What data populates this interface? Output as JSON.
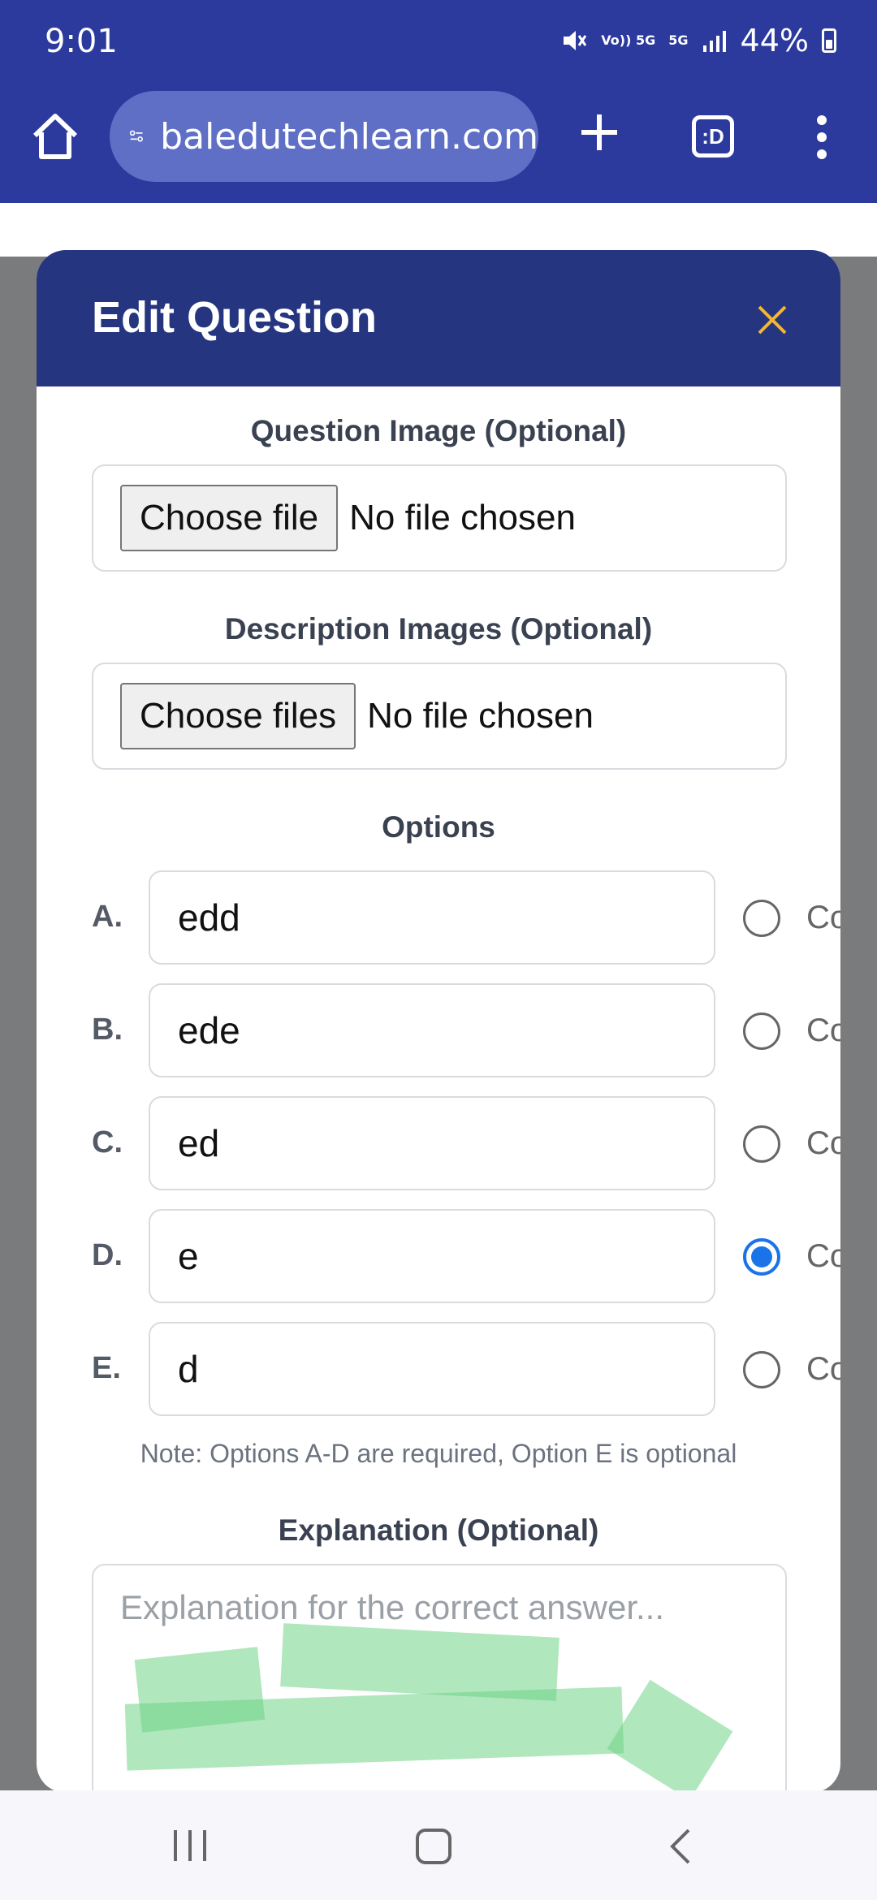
{
  "status_bar": {
    "time": "9:01",
    "network_volte": "Vo)) 5G",
    "network_type": "5G",
    "battery": "44%"
  },
  "browser": {
    "url": "baledutechlearn.com",
    "tabs_label": ":D"
  },
  "modal": {
    "title": "Edit Question",
    "question_image": {
      "label": "Question Image (Optional)",
      "button": "Choose file",
      "status": "No file chosen"
    },
    "description_images": {
      "label": "Description Images (Optional)",
      "button": "Choose files",
      "status": "No file chosen"
    },
    "options_label": "Options",
    "options": [
      {
        "letter": "A.",
        "value": "edd",
        "correct_label": "Co",
        "checked": false
      },
      {
        "letter": "B.",
        "value": "ede",
        "correct_label": "Co",
        "checked": false
      },
      {
        "letter": "C.",
        "value": "ed",
        "correct_label": "Co",
        "checked": false
      },
      {
        "letter": "D.",
        "value": "e",
        "correct_label": "Co",
        "checked": true
      },
      {
        "letter": "E.",
        "value": "d",
        "correct_label": "Co",
        "checked": false
      }
    ],
    "note": "Note: Options A-D are required, Option E is optional",
    "explanation": {
      "label": "Explanation (Optional)",
      "placeholder": "Explanation for the correct answer..."
    }
  },
  "colors": {
    "browser_bar": "#2b3a9c",
    "modal_header": "#25357f",
    "close_icon": "#f5b731",
    "radio_checked": "#1a73e8"
  }
}
